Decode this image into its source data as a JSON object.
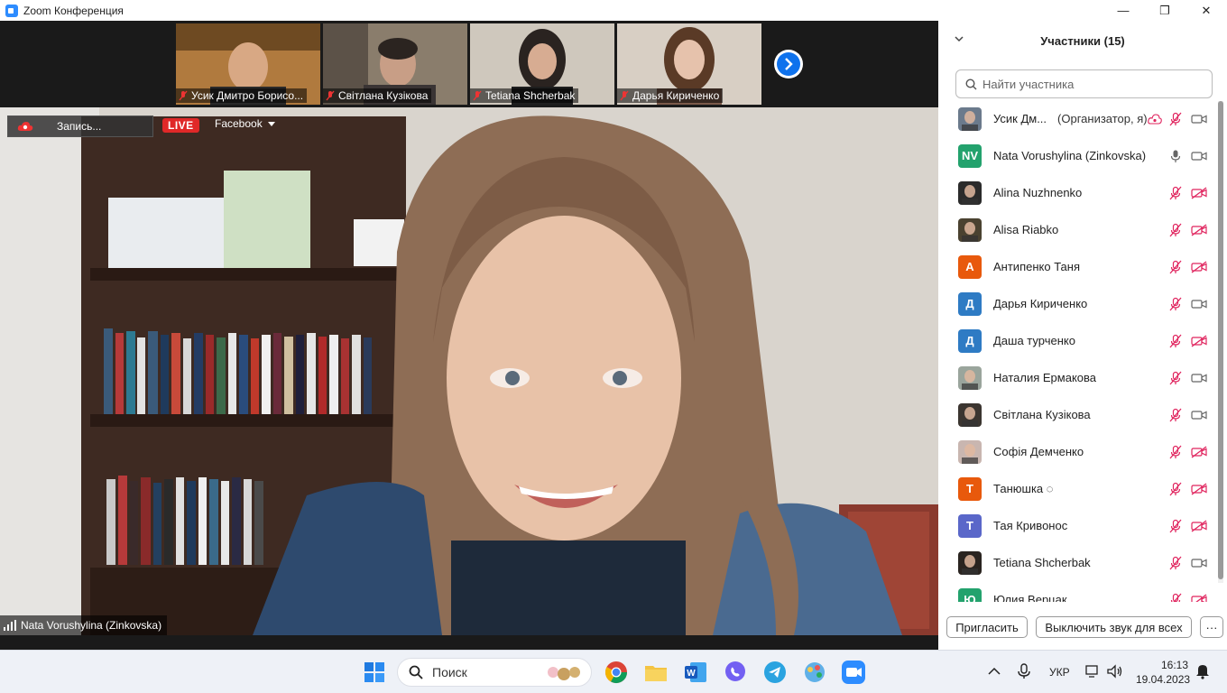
{
  "window": {
    "title": "Zoom Конференция",
    "controls": [
      "—",
      "❐",
      "✕"
    ]
  },
  "thumbnails": [
    {
      "name": "Усик Дмитро Борисо...",
      "bg": "#b07a3e"
    },
    {
      "name": "Світлана Кузікова",
      "bg": "#8a7d6c"
    },
    {
      "name": "Tetiana Shcherbak",
      "bg": "#cfc8bd"
    },
    {
      "name": "Дарья Кириченко",
      "bg": "#d8cfc4"
    }
  ],
  "main": {
    "recording_label": "Запись...",
    "live_label": "LIVE",
    "stream_target": "Facebook",
    "speaker_name": "Nata Vorushylina (Zinkovska)"
  },
  "panel": {
    "title": "Участники (15)",
    "search_placeholder": "Найти участника",
    "participants": [
      {
        "name": "Усик Дм...",
        "role": "(Организатор, я)",
        "avatar_text": "",
        "avatar_color": "#6b7a8c",
        "mic": "muted",
        "cam": "on",
        "rec": true
      },
      {
        "name": "Nata Vorushylina (Zinkovska)",
        "role": "",
        "avatar_text": "NV",
        "avatar_color": "#23a26d",
        "mic": "on",
        "cam": "on",
        "rec": false
      },
      {
        "name": "Alina Nuzhnenko",
        "role": "",
        "avatar_text": "",
        "avatar_color": "#2b2b2b",
        "mic": "muted",
        "cam": "off",
        "rec": false
      },
      {
        "name": "Alisa Riabko",
        "role": "",
        "avatar_text": "",
        "avatar_color": "#4a4230",
        "mic": "muted",
        "cam": "off",
        "rec": false
      },
      {
        "name": "Антипенко Таня",
        "role": "",
        "avatar_text": "А",
        "avatar_color": "#e8590c",
        "mic": "muted",
        "cam": "off",
        "rec": false
      },
      {
        "name": "Дарья Кириченко",
        "role": "",
        "avatar_text": "Д",
        "avatar_color": "#2e7bc4",
        "mic": "muted",
        "cam": "on",
        "rec": false
      },
      {
        "name": "Даша турченко",
        "role": "",
        "avatar_text": "Д",
        "avatar_color": "#2e7bc4",
        "mic": "muted",
        "cam": "off",
        "rec": false
      },
      {
        "name": "Наталия Ермакова",
        "role": "",
        "avatar_text": "",
        "avatar_color": "#9aa59c",
        "mic": "muted",
        "cam": "on",
        "rec": false
      },
      {
        "name": "Світлана Кузікова",
        "role": "",
        "avatar_text": "",
        "avatar_color": "#3b3530",
        "mic": "muted",
        "cam": "on",
        "rec": false
      },
      {
        "name": "Софія Демченко",
        "role": "",
        "avatar_text": "",
        "avatar_color": "#c9b6b0",
        "mic": "muted",
        "cam": "off",
        "rec": false
      },
      {
        "name": "Танюшка ◌",
        "role": "",
        "avatar_text": "Т",
        "avatar_color": "#e8590c",
        "mic": "muted",
        "cam": "off",
        "rec": false
      },
      {
        "name": "Тая Кривонос",
        "role": "",
        "avatar_text": "Т",
        "avatar_color": "#5a67c9",
        "mic": "muted",
        "cam": "off",
        "rec": false
      },
      {
        "name": "Tetiana Shcherbak",
        "role": "",
        "avatar_text": "",
        "avatar_color": "#2a2420",
        "mic": "muted",
        "cam": "on",
        "rec": false
      },
      {
        "name": "Юлия Верцак",
        "role": "",
        "avatar_text": "Ю",
        "avatar_color": "#23a26d",
        "mic": "muted",
        "cam": "off",
        "rec": false
      }
    ],
    "invite_label": "Пригласить",
    "mute_all_label": "Выключить звук для всех",
    "more_label": "···"
  },
  "taskbar": {
    "search_label": "Поиск",
    "lang": "УКР",
    "time": "16:13",
    "date": "19.04.2023"
  }
}
